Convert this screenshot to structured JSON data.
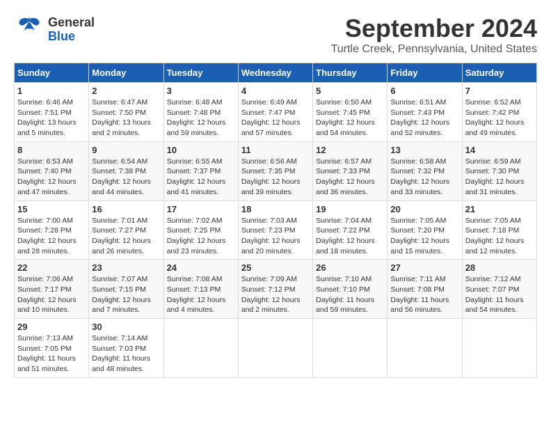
{
  "header": {
    "logo_general": "General",
    "logo_blue": "Blue",
    "title": "September 2024",
    "subtitle": "Turtle Creek, Pennsylvania, United States"
  },
  "calendar": {
    "days_of_week": [
      "Sunday",
      "Monday",
      "Tuesday",
      "Wednesday",
      "Thursday",
      "Friday",
      "Saturday"
    ],
    "weeks": [
      [
        {
          "day": "1",
          "sunrise": "Sunrise: 6:46 AM",
          "sunset": "Sunset: 7:51 PM",
          "daylight": "Daylight: 13 hours and 5 minutes."
        },
        {
          "day": "2",
          "sunrise": "Sunrise: 6:47 AM",
          "sunset": "Sunset: 7:50 PM",
          "daylight": "Daylight: 13 hours and 2 minutes."
        },
        {
          "day": "3",
          "sunrise": "Sunrise: 6:48 AM",
          "sunset": "Sunset: 7:48 PM",
          "daylight": "Daylight: 12 hours and 59 minutes."
        },
        {
          "day": "4",
          "sunrise": "Sunrise: 6:49 AM",
          "sunset": "Sunset: 7:47 PM",
          "daylight": "Daylight: 12 hours and 57 minutes."
        },
        {
          "day": "5",
          "sunrise": "Sunrise: 6:50 AM",
          "sunset": "Sunset: 7:45 PM",
          "daylight": "Daylight: 12 hours and 54 minutes."
        },
        {
          "day": "6",
          "sunrise": "Sunrise: 6:51 AM",
          "sunset": "Sunset: 7:43 PM",
          "daylight": "Daylight: 12 hours and 52 minutes."
        },
        {
          "day": "7",
          "sunrise": "Sunrise: 6:52 AM",
          "sunset": "Sunset: 7:42 PM",
          "daylight": "Daylight: 12 hours and 49 minutes."
        }
      ],
      [
        {
          "day": "8",
          "sunrise": "Sunrise: 6:53 AM",
          "sunset": "Sunset: 7:40 PM",
          "daylight": "Daylight: 12 hours and 47 minutes."
        },
        {
          "day": "9",
          "sunrise": "Sunrise: 6:54 AM",
          "sunset": "Sunset: 7:38 PM",
          "daylight": "Daylight: 12 hours and 44 minutes."
        },
        {
          "day": "10",
          "sunrise": "Sunrise: 6:55 AM",
          "sunset": "Sunset: 7:37 PM",
          "daylight": "Daylight: 12 hours and 41 minutes."
        },
        {
          "day": "11",
          "sunrise": "Sunrise: 6:56 AM",
          "sunset": "Sunset: 7:35 PM",
          "daylight": "Daylight: 12 hours and 39 minutes."
        },
        {
          "day": "12",
          "sunrise": "Sunrise: 6:57 AM",
          "sunset": "Sunset: 7:33 PM",
          "daylight": "Daylight: 12 hours and 36 minutes."
        },
        {
          "day": "13",
          "sunrise": "Sunrise: 6:58 AM",
          "sunset": "Sunset: 7:32 PM",
          "daylight": "Daylight: 12 hours and 33 minutes."
        },
        {
          "day": "14",
          "sunrise": "Sunrise: 6:59 AM",
          "sunset": "Sunset: 7:30 PM",
          "daylight": "Daylight: 12 hours and 31 minutes."
        }
      ],
      [
        {
          "day": "15",
          "sunrise": "Sunrise: 7:00 AM",
          "sunset": "Sunset: 7:28 PM",
          "daylight": "Daylight: 12 hours and 28 minutes."
        },
        {
          "day": "16",
          "sunrise": "Sunrise: 7:01 AM",
          "sunset": "Sunset: 7:27 PM",
          "daylight": "Daylight: 12 hours and 26 minutes."
        },
        {
          "day": "17",
          "sunrise": "Sunrise: 7:02 AM",
          "sunset": "Sunset: 7:25 PM",
          "daylight": "Daylight: 12 hours and 23 minutes."
        },
        {
          "day": "18",
          "sunrise": "Sunrise: 7:03 AM",
          "sunset": "Sunset: 7:23 PM",
          "daylight": "Daylight: 12 hours and 20 minutes."
        },
        {
          "day": "19",
          "sunrise": "Sunrise: 7:04 AM",
          "sunset": "Sunset: 7:22 PM",
          "daylight": "Daylight: 12 hours and 18 minutes."
        },
        {
          "day": "20",
          "sunrise": "Sunrise: 7:05 AM",
          "sunset": "Sunset: 7:20 PM",
          "daylight": "Daylight: 12 hours and 15 minutes."
        },
        {
          "day": "21",
          "sunrise": "Sunrise: 7:05 AM",
          "sunset": "Sunset: 7:18 PM",
          "daylight": "Daylight: 12 hours and 12 minutes."
        }
      ],
      [
        {
          "day": "22",
          "sunrise": "Sunrise: 7:06 AM",
          "sunset": "Sunset: 7:17 PM",
          "daylight": "Daylight: 12 hours and 10 minutes."
        },
        {
          "day": "23",
          "sunrise": "Sunrise: 7:07 AM",
          "sunset": "Sunset: 7:15 PM",
          "daylight": "Daylight: 12 hours and 7 minutes."
        },
        {
          "day": "24",
          "sunrise": "Sunrise: 7:08 AM",
          "sunset": "Sunset: 7:13 PM",
          "daylight": "Daylight: 12 hours and 4 minutes."
        },
        {
          "day": "25",
          "sunrise": "Sunrise: 7:09 AM",
          "sunset": "Sunset: 7:12 PM",
          "daylight": "Daylight: 12 hours and 2 minutes."
        },
        {
          "day": "26",
          "sunrise": "Sunrise: 7:10 AM",
          "sunset": "Sunset: 7:10 PM",
          "daylight": "Daylight: 11 hours and 59 minutes."
        },
        {
          "day": "27",
          "sunrise": "Sunrise: 7:11 AM",
          "sunset": "Sunset: 7:08 PM",
          "daylight": "Daylight: 11 hours and 56 minutes."
        },
        {
          "day": "28",
          "sunrise": "Sunrise: 7:12 AM",
          "sunset": "Sunset: 7:07 PM",
          "daylight": "Daylight: 11 hours and 54 minutes."
        }
      ],
      [
        {
          "day": "29",
          "sunrise": "Sunrise: 7:13 AM",
          "sunset": "Sunset: 7:05 PM",
          "daylight": "Daylight: 11 hours and 51 minutes."
        },
        {
          "day": "30",
          "sunrise": "Sunrise: 7:14 AM",
          "sunset": "Sunset: 7:03 PM",
          "daylight": "Daylight: 11 hours and 48 minutes."
        },
        null,
        null,
        null,
        null,
        null
      ]
    ]
  }
}
